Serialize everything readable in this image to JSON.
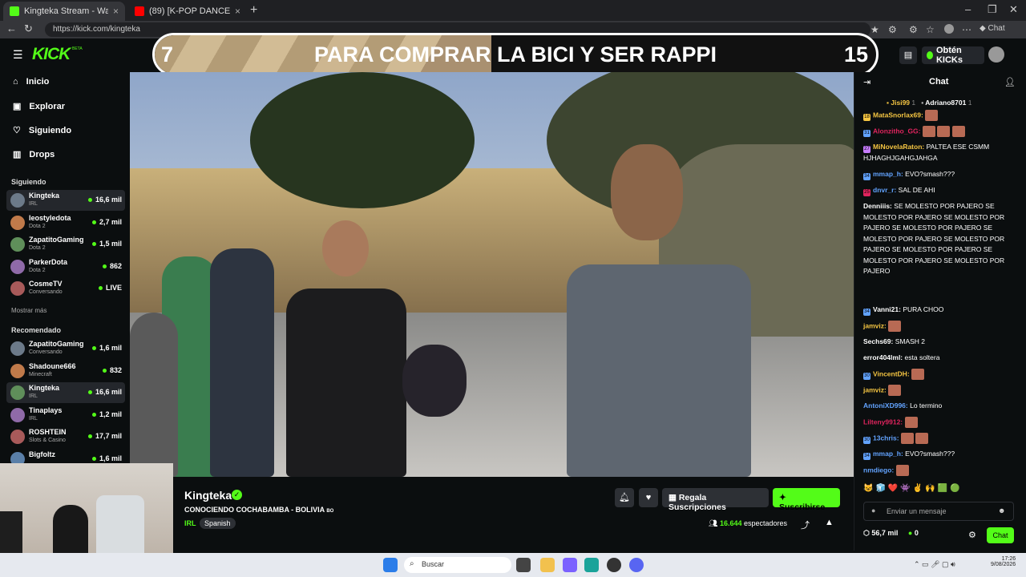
{
  "browser": {
    "tabs": [
      {
        "label": "Kingteka Stream - Watch Live on K",
        "active": true
      },
      {
        "label": "(89) [K-POP DANCE IN PUBLIC | O",
        "active": false
      }
    ],
    "url": "https://kick.com/kingteka"
  },
  "header": {
    "logo": "KICK",
    "logo_badge": "BETA",
    "banner": {
      "left_number": "7",
      "text": "PARA COMPRAR LA BICI Y SER RAPPI",
      "right_number": "15"
    },
    "kicks_label": "Obtén KICKs"
  },
  "sidebar": {
    "nav": [
      {
        "label": "Inicio",
        "icon": "home-icon"
      },
      {
        "label": "Explorar",
        "icon": "explore-icon"
      },
      {
        "label": "Siguiendo",
        "icon": "heart-icon"
      },
      {
        "label": "Drops",
        "icon": "drops-icon"
      }
    ],
    "following_title": "Siguiendo",
    "following": [
      {
        "name": "Kingteka",
        "category": "IRL",
        "viewers": "16,6 mil",
        "active": true
      },
      {
        "name": "leostyledota",
        "category": "Dota 2",
        "viewers": "2,7 mil"
      },
      {
        "name": "ZapatitoGaming",
        "category": "Dota 2",
        "viewers": "1,5 mil"
      },
      {
        "name": "ParkerDota",
        "category": "Dota 2",
        "viewers": "862"
      },
      {
        "name": "CosmeTV",
        "category": "Conversando",
        "viewers": "LIVE"
      }
    ],
    "show_more": "Mostrar más",
    "recommended_title": "Recomendado",
    "recommended": [
      {
        "name": "ZapatitoGaming",
        "category": "Conversando",
        "viewers": "1,6 mil"
      },
      {
        "name": "Shadoune666",
        "category": "Minecraft",
        "viewers": "832"
      },
      {
        "name": "Kingteka",
        "category": "IRL",
        "viewers": "16,6 mil",
        "active": true
      },
      {
        "name": "Tinaplays",
        "category": "IRL",
        "viewers": "1,2 mil"
      },
      {
        "name": "ROSHTEIN",
        "category": "Slots & Casino",
        "viewers": "17,7 mil"
      },
      {
        "name": "Bigfoltz",
        "category": "",
        "viewers": "1,6 mil"
      }
    ]
  },
  "stream": {
    "streamer": "Kingteka",
    "title": "CONOCIENDO COCHABAMBA - BOLIVIA",
    "title_flag": "BO",
    "category": "IRL",
    "language": "Spanish",
    "gift_label": "Regala Suscripciones",
    "subscribe_label": "Suscribirse",
    "viewers": "16.644",
    "viewers_label": "espectadores"
  },
  "chat": {
    "title": "Chat",
    "top_gifters": [
      {
        "name": "Jisi99",
        "count": "1"
      },
      {
        "name": "Adriano8701",
        "count": "1"
      }
    ],
    "messages": [
      {
        "user": "MataSnorlax69:",
        "text": "",
        "color": "#f5c542",
        "badge": "18",
        "emotes": 1
      },
      {
        "user": "Alonzitho_GG:",
        "text": "",
        "color": "#e0245e",
        "badge": "31",
        "emotes": 3
      },
      {
        "user": "MiNovelaRaton:",
        "text": "PALTEA ESE CSMM HJHAGHJGAHGJAHGA",
        "color": "#f5c542",
        "badge": "27"
      },
      {
        "user": "mmap_h:",
        "text": "EVO?smash???",
        "color": "#62a3ff",
        "badge": "34"
      },
      {
        "user": "dnvr_r:",
        "text": "SAL DE AHI",
        "color": "#62a3ff",
        "badge": "25"
      },
      {
        "user": "Denniiis:",
        "text": "SE MOLESTO POR PAJERO SE MOLESTO POR PAJERO SE MOLESTO POR PAJERO SE MOLESTO POR PAJERO SE MOLESTO POR PAJERO SE MOLESTO POR PAJERO SE MOLESTO POR PAJERO SE MOLESTO POR PAJERO SE MOLESTO POR PAJERO",
        "color": "#ffffff",
        "badge": ""
      },
      {
        "user": "Vanni21:",
        "text": "PURA CHOO",
        "color": "#ffffff",
        "badge": "34"
      },
      {
        "user": "jamviz:",
        "text": "",
        "color": "#f5c542",
        "badge": "",
        "emotes": 1
      },
      {
        "user": "Sechs69:",
        "text": "SMASH 2",
        "color": "#ffffff",
        "badge": ""
      },
      {
        "user": "error404lml:",
        "text": "esta soltera",
        "color": "#ffffff",
        "badge": ""
      },
      {
        "user": "VincentDH:",
        "text": "",
        "color": "#f5c542",
        "badge": "30",
        "emotes": 1
      },
      {
        "user": "jamviz:",
        "text": "",
        "color": "#f5c542",
        "badge": "",
        "emotes": 1
      },
      {
        "user": "AntoniXD996:",
        "text": "Lo termino",
        "color": "#62a3ff",
        "badge": ""
      },
      {
        "user": "Lilteny9912:",
        "text": "",
        "color": "#e0245e",
        "badge": "",
        "emotes": 1
      },
      {
        "user": "13chris:",
        "text": "",
        "color": "#62a3ff",
        "badge": "30",
        "emotes": 2
      },
      {
        "user": "mmap_h:",
        "text": "EVO?smash???",
        "color": "#62a3ff",
        "badge": "34"
      },
      {
        "user": "nmdiego:",
        "text": "",
        "color": "#62a3ff",
        "badge": "",
        "emotes": 1
      }
    ],
    "input_placeholder": "Enviar un mensaje",
    "points": "56,7 mil",
    "kicks": "0",
    "send_label": "Chat"
  },
  "taskbar": {
    "search_placeholder": "Buscar",
    "time": "17:26",
    "date": "9/08/2026"
  }
}
